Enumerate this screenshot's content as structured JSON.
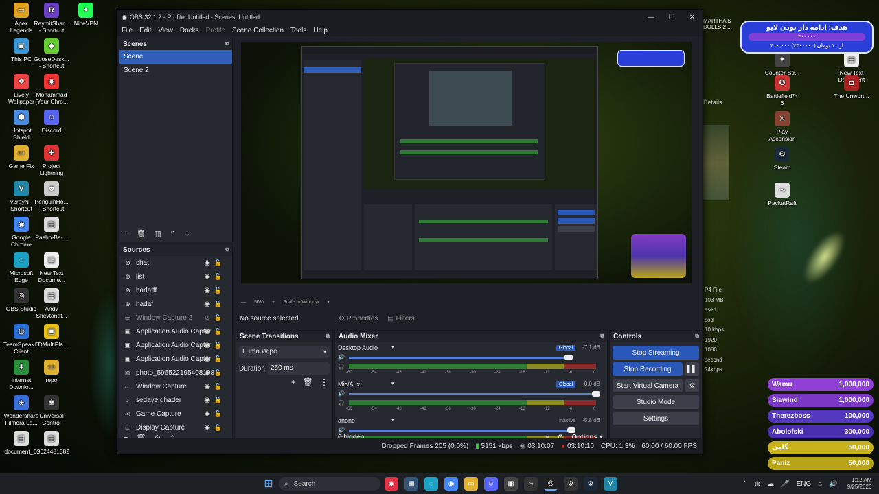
{
  "desktop": {
    "left_icons": [
      {
        "label": "Apex Legends",
        "color": "#e0a020",
        "glyph": "▭"
      },
      {
        "label": "ReymitShar... - Shortcut",
        "color": "#6a3fc4",
        "glyph": "R"
      },
      {
        "label": "NiceVPN",
        "color": "#2f5",
        "glyph": "✦"
      },
      {
        "label": "This PC",
        "color": "#3a9ad9",
        "glyph": "▣"
      },
      {
        "label": "GooseDesk... - Shortcut",
        "color": "#6c3",
        "glyph": "◆"
      },
      {
        "label": "Lively Wallpaper",
        "color": "#e44",
        "glyph": "❖"
      },
      {
        "label": "Mohammad (Your Chro...",
        "color": "#e33",
        "glyph": "◉"
      },
      {
        "label": "Hotspot Shield",
        "color": "#4a8de0",
        "glyph": "⬢"
      },
      {
        "label": "Discord",
        "color": "#5865f2",
        "glyph": "☺"
      },
      {
        "label": "Game Fix",
        "color": "#e0b030",
        "glyph": "▭"
      },
      {
        "label": "Project Lightning",
        "color": "#d33",
        "glyph": "✚"
      },
      {
        "label": "v2rayN - Shortcut",
        "color": "#28a",
        "glyph": "V"
      },
      {
        "label": "PenguinHo... - Shortcut",
        "color": "#ccc",
        "glyph": "☻"
      },
      {
        "label": "Google Chrome",
        "color": "#4285f4",
        "glyph": "◉"
      },
      {
        "label": "Pasho-Ba-...",
        "color": "#ddd",
        "glyph": "▤"
      },
      {
        "label": "Microsoft Edge",
        "color": "#1ba1c4",
        "glyph": "◌"
      },
      {
        "label": "New Text Docume...",
        "color": "#eee",
        "glyph": "▤"
      },
      {
        "label": "OBS Studio",
        "color": "#333",
        "glyph": "◎"
      },
      {
        "label": "Andy Sheytanat...",
        "color": "#ddd",
        "glyph": "▤"
      },
      {
        "label": "TeamSpeak 3 Client",
        "color": "#2a6fd6",
        "glyph": "◍"
      },
      {
        "label": "LDMultiPla...",
        "color": "#e8c21a",
        "glyph": "▣"
      },
      {
        "label": "Internet Downlo...",
        "color": "#2a8f3a",
        "glyph": "⬇"
      },
      {
        "label": "repo",
        "color": "#e0b030",
        "glyph": "▭"
      },
      {
        "label": "Wondershare Filmora La...",
        "color": "#3a6fd9",
        "glyph": "◈"
      },
      {
        "label": "Universal Control",
        "color": "#333",
        "glyph": "♚"
      },
      {
        "label": "document_...",
        "color": "#ddd",
        "glyph": "▤"
      },
      {
        "label": "09024481382",
        "color": "#ddd",
        "glyph": "▤"
      }
    ],
    "right_icons": [
      {
        "label": "Counter-Str... 2",
        "color": "#444",
        "glyph": "✦"
      },
      {
        "label": "New Text Document",
        "color": "#eee",
        "glyph": "▤"
      },
      {
        "label": "Battlefield™ 6",
        "color": "#c33",
        "glyph": "✪"
      },
      {
        "label": "The Unwort...",
        "color": "#a22",
        "glyph": "◘"
      },
      {
        "label": "Play Ascension",
        "color": "#843",
        "glyph": "⚔"
      },
      {
        "label": "Steam",
        "color": "#1b2838",
        "glyph": "⚙"
      },
      {
        "label": "PacketRaft",
        "color": "#ddd",
        "glyph": "⤳"
      }
    ],
    "partial_text_right": "MARTHA'S\nDOLLS 2 ...",
    "side_stats": [
      "P4 File",
      "103 MB",
      "ssed cod",
      "10 kbps",
      "1920",
      "1080",
      "second",
      "?4kbps"
    ]
  },
  "goal_widget": {
    "title": "هدف: ادامه دار بودن لایو",
    "progress_label": "۴۰۰۰۰۰",
    "footer": "۴۰۰,۰۰۰ از ۱۰ تومان (۴۰۰۰۰۰٪)"
  },
  "donations": [
    {
      "name": "Wamu",
      "amount": "1,000,000",
      "color": "#8f3fd6"
    },
    {
      "name": "Siawind",
      "amount": "1,000,000",
      "color": "#7a38c4"
    },
    {
      "name": "Therezboss",
      "amount": "100,000",
      "color": "#5438c0"
    },
    {
      "name": "Abolofski",
      "amount": "300,000",
      "color": "#4a2fb0"
    },
    {
      "name": "گلبی",
      "amount": "50,000",
      "color": "#c9b21a"
    },
    {
      "name": "Paniz",
      "amount": "50,000",
      "color": "#b8a418"
    }
  ],
  "obs": {
    "title": "OBS 32.1.2 - Profile: Untitled - Scenes: Untitled",
    "menu": [
      "File",
      "Edit",
      "View",
      "Docks",
      "Profile",
      "Scene Collection",
      "Tools",
      "Help"
    ],
    "scenes_header": "Scenes",
    "scenes": [
      "Scene",
      "Scene 2"
    ],
    "sources_header": "Sources",
    "sources": [
      {
        "name": "chat",
        "icon": "globe-icon",
        "glyph": "⊕",
        "hidden": false
      },
      {
        "name": "list",
        "icon": "globe-icon",
        "glyph": "⊕",
        "hidden": false
      },
      {
        "name": "hadafff",
        "icon": "globe-icon",
        "glyph": "⊕",
        "hidden": false
      },
      {
        "name": "hadaf",
        "icon": "globe-icon",
        "glyph": "⊕",
        "hidden": false
      },
      {
        "name": "Window Capture 2",
        "icon": "window-icon",
        "glyph": "▭",
        "hidden": true
      },
      {
        "name": "Application Audio Captur",
        "icon": "app-audio-icon",
        "glyph": "▣",
        "hidden": false
      },
      {
        "name": "Application Audio Captur",
        "icon": "app-audio-icon",
        "glyph": "▣",
        "hidden": false
      },
      {
        "name": "Application Audio Captur",
        "icon": "app-audio-icon",
        "glyph": "▣",
        "hidden": false
      },
      {
        "name": "photo_596522195408198",
        "icon": "image-icon",
        "glyph": "▨",
        "hidden": false
      },
      {
        "name": "Window Capture",
        "icon": "window-icon",
        "glyph": "▭",
        "hidden": false
      },
      {
        "name": "sedaye ghader",
        "icon": "mic-icon",
        "glyph": "♪",
        "hidden": false
      },
      {
        "name": "Game Capture",
        "icon": "gamepad-icon",
        "glyph": "◎",
        "hidden": false
      },
      {
        "name": "Display Capture",
        "icon": "monitor-icon",
        "glyph": "▭",
        "hidden": false
      }
    ],
    "preview_zoom": "50%",
    "preview_fit": "Scale to Window",
    "no_source": "No source selected",
    "properties": "Properties",
    "filters": "Filters",
    "transitions_header": "Scene Transitions",
    "transition": "Luma Wipe",
    "duration_label": "Duration",
    "duration_value": "250 ms",
    "mixer_header": "Audio Mixer",
    "channels": [
      {
        "name": "Desktop Audio",
        "tag": "Global",
        "db": "-7.1 dB",
        "level": 0.89
      },
      {
        "name": "Mic/Aux",
        "tag": "Global",
        "db": "0.0 dB",
        "level": 1.0
      },
      {
        "name": "anone",
        "tag": "Inactive",
        "db": "-5.8 dB",
        "level": 0.9
      }
    ],
    "ticks": [
      "-60",
      "-54",
      "-48",
      "-42",
      "-36",
      "-30",
      "-24",
      "-18",
      "-12",
      "-6",
      "0"
    ],
    "hidden_count": "0 hidden",
    "options": "Options",
    "controls_header": "Controls",
    "controls": {
      "stream": "Stop Streaming",
      "record": "Stop Recording",
      "vcam": "Start Virtual Camera",
      "studio": "Studio Mode",
      "settings": "Settings"
    },
    "status": {
      "dropped": "Dropped Frames 205 (0.0%)",
      "kbps": "5151 kbps",
      "stream_time": "03:10:07",
      "rec_time": "03:10:10",
      "cpu": "CPU: 1.3%",
      "fps": "60.00 / 60.00 FPS"
    }
  },
  "taskbar": {
    "search": "Search",
    "lang": "ENG",
    "time": "1:12 AM",
    "date": "9/25/2026"
  }
}
